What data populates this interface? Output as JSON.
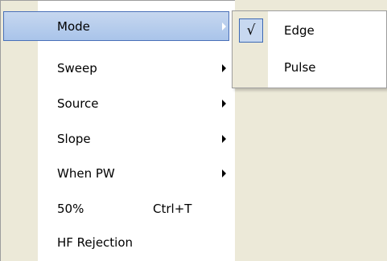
{
  "menu": {
    "items": [
      {
        "label": "Mode",
        "has_submenu": true,
        "highlighted": true
      },
      {
        "label": "Sweep",
        "has_submenu": true
      },
      {
        "label": "Source",
        "has_submenu": true
      },
      {
        "label": "Slope",
        "has_submenu": true
      },
      {
        "label": "When PW",
        "has_submenu": true
      },
      {
        "label": "50%",
        "shortcut": "Ctrl+T"
      },
      {
        "label": "HF Rejection"
      }
    ]
  },
  "submenu": {
    "items": [
      {
        "label": "Edge",
        "checked": true,
        "check_glyph": "√"
      },
      {
        "label": "Pulse",
        "checked": false
      }
    ]
  },
  "icons": {
    "submenu_arrow": "chevron-right-icon",
    "check": "check-icon"
  },
  "colors": {
    "menu_background": "#ffffff",
    "gutter": "#ece9d8",
    "highlight": "#b6cdee",
    "highlight_border": "#4a70b8"
  }
}
